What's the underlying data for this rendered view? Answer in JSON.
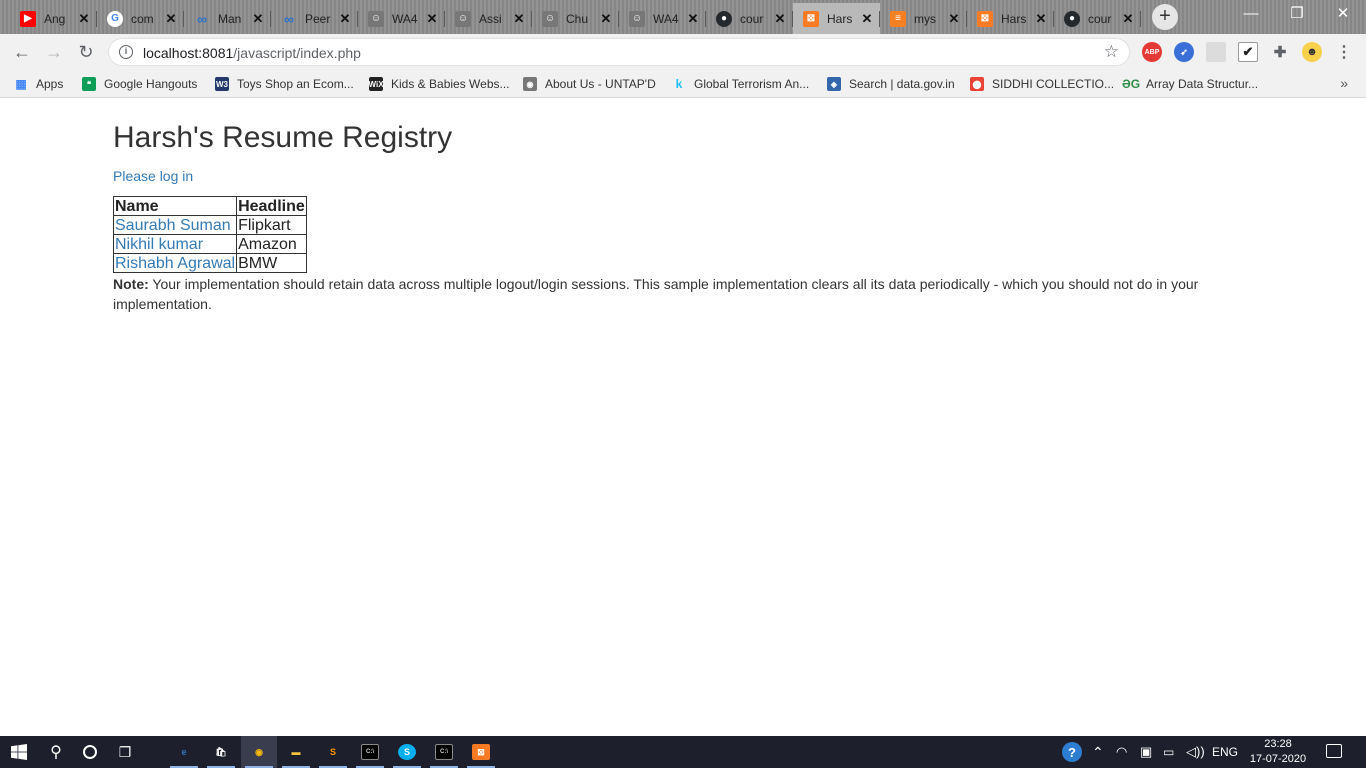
{
  "browser": {
    "tabs": [
      {
        "title": "Ang",
        "icon": "youtube-icon",
        "color": "#ff0000"
      },
      {
        "title": "com",
        "icon": "google-icon",
        "color": "#4285f4"
      },
      {
        "title": "Man",
        "icon": "coursera-icon",
        "color": "#2a73cc"
      },
      {
        "title": "Peer",
        "icon": "coursera-icon",
        "color": "#2a73cc"
      },
      {
        "title": "WA4",
        "icon": "avatar-icon",
        "color": "#777777"
      },
      {
        "title": "Assi",
        "icon": "avatar-icon",
        "color": "#777777"
      },
      {
        "title": "Chu",
        "icon": "avatar-icon",
        "color": "#777777"
      },
      {
        "title": "WA4",
        "icon": "avatar-icon",
        "color": "#777777"
      },
      {
        "title": "cour",
        "icon": "github-icon",
        "color": "#24292e"
      },
      {
        "title": "Hars",
        "icon": "xampp-icon",
        "color": "#fb7a24"
      },
      {
        "title": "mys",
        "icon": "stackoverflow-icon",
        "color": "#f48024"
      },
      {
        "title": "Hars",
        "icon": "xampp-icon",
        "color": "#fb7a24"
      },
      {
        "title": "cour",
        "icon": "github-icon",
        "color": "#24292e"
      }
    ],
    "active_tab_index": 9,
    "close_glyph": "✕",
    "new_tab_glyph": "+",
    "window_controls": {
      "minimize": "—",
      "maximize": "❐",
      "close": "✕"
    },
    "address_bar": {
      "host": "localhost:8081",
      "path": "/javascript/index.php"
    },
    "bookmarks": [
      {
        "label": "Apps",
        "icon": "apps-grid-icon",
        "color": "#4285f4"
      },
      {
        "label": "Google Hangouts",
        "icon": "hangouts-icon",
        "color": "#0f9d58"
      },
      {
        "label": "Toys Shop an Ecom...",
        "icon": "w3schools-icon",
        "color": "#23396b"
      },
      {
        "label": "Kids & Babies Webs...",
        "icon": "wix-icon",
        "color": "#222222"
      },
      {
        "label": "About Us - UNTAP'D",
        "icon": "globe-icon",
        "color": "#777777"
      },
      {
        "label": "Global Terrorism An...",
        "icon": "kaggle-icon",
        "color": "#20beff"
      },
      {
        "label": "Search | data.gov.in",
        "icon": "datagov-icon",
        "color": "#3366aa"
      },
      {
        "label": "SIDDHI COLLECTIO...",
        "icon": "maps-pin-icon",
        "color": "#ea4335"
      },
      {
        "label": "Array Data Structur...",
        "icon": "geeksforgeeks-icon",
        "color": "#2f8d46"
      }
    ],
    "bookmarks_more": "»"
  },
  "page": {
    "title": "Harsh's Resume Registry",
    "login_link": "Please log in",
    "table": {
      "headers": [
        "Name",
        "Headline"
      ],
      "rows": [
        {
          "name": "Saurabh Suman",
          "headline": "Flipkart"
        },
        {
          "name": "Nikhil kumar",
          "headline": "Amazon"
        },
        {
          "name": "Rishabh Agrawal",
          "headline": "BMW"
        }
      ]
    },
    "note_label": "Note:",
    "note_text": " Your implementation should retain data across multiple logout/login sessions. This sample implementation clears all its data periodically - which you should not do in your implementation."
  },
  "taskbar": {
    "language": "ENG",
    "time": "23:28",
    "date": "17-07-2020",
    "apps": [
      {
        "name": "edge-icon",
        "color": "#3277bc"
      },
      {
        "name": "store-icon",
        "color": "#ffffff"
      },
      {
        "name": "chrome-icon",
        "color": "#fbbc05"
      },
      {
        "name": "file-explorer-icon",
        "color": "#f6c343"
      },
      {
        "name": "sublime-text-icon",
        "color": "#ff9800"
      },
      {
        "name": "cmd-icon",
        "color": "#cccccc"
      },
      {
        "name": "skype-icon",
        "color": "#00aff0"
      },
      {
        "name": "cmd-icon",
        "color": "#cccccc"
      },
      {
        "name": "xampp-icon",
        "color": "#fb7a24"
      }
    ]
  }
}
